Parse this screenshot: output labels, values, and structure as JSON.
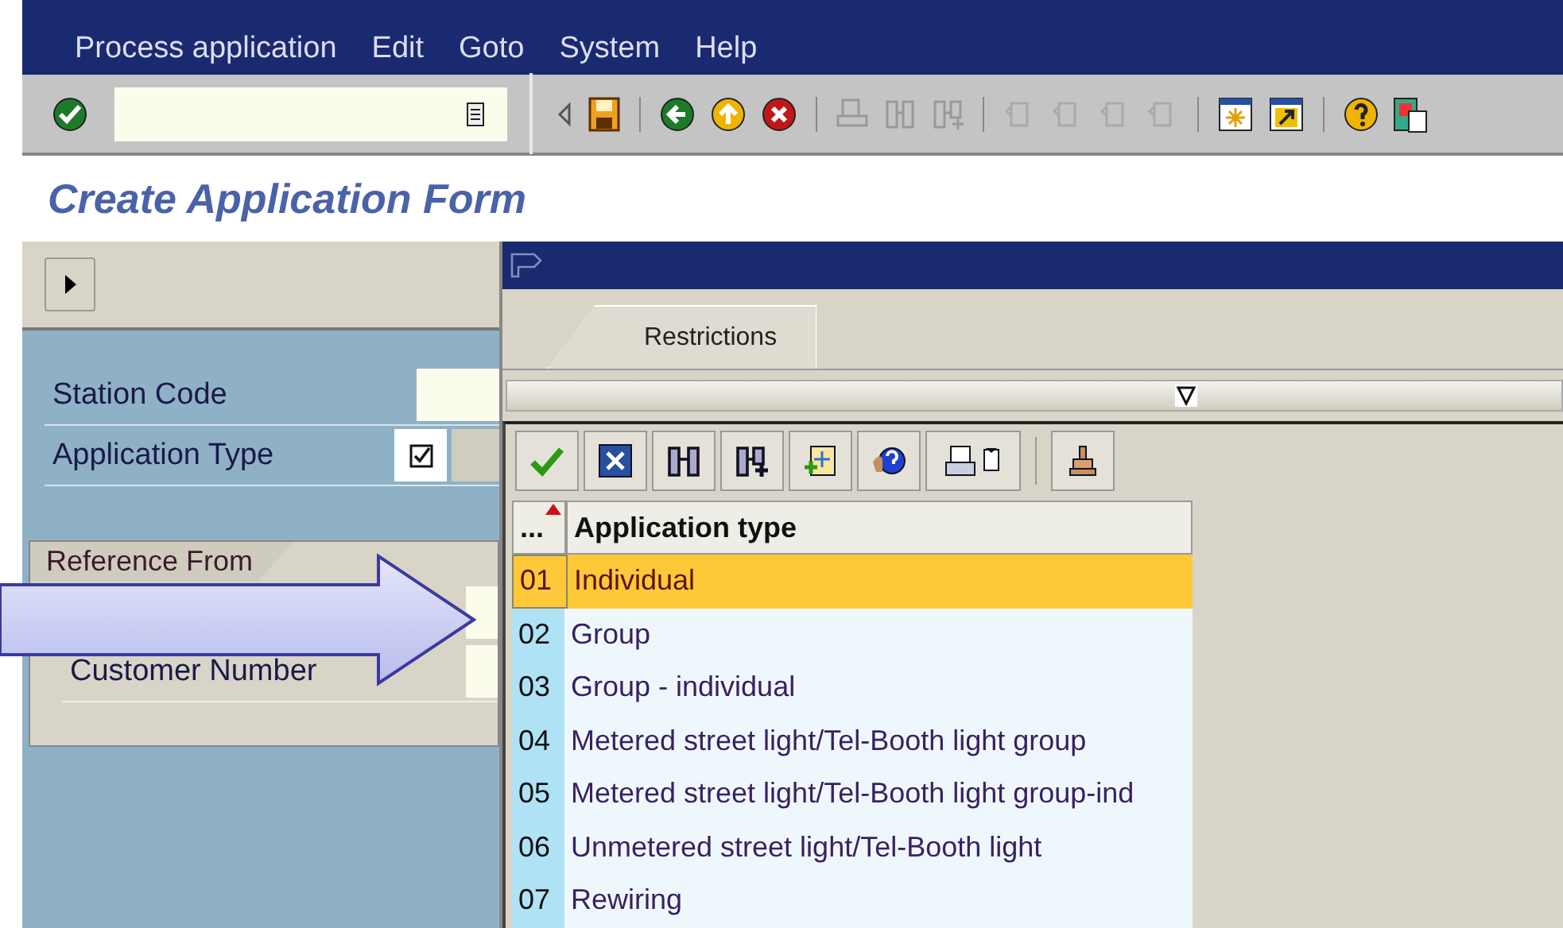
{
  "menu": [
    "Process application",
    "Edit",
    "Goto",
    "System",
    "Help"
  ],
  "title": "Create Application Form",
  "side_panel": {
    "fields": [
      {
        "label": "Station Code",
        "kind": "input"
      },
      {
        "label": "Application Type",
        "kind": "lookup"
      }
    ],
    "group": {
      "title": "Reference From",
      "fields": [
        {
          "label": "Customer Number",
          "kind": "input"
        }
      ]
    }
  },
  "dialog": {
    "tabs": [
      {
        "label": "Restrictions",
        "selected": true
      }
    ],
    "table": {
      "columns": [
        "...",
        "Application type"
      ],
      "rows": [
        {
          "code": "01",
          "text": "Individual",
          "selected": true
        },
        {
          "code": "02",
          "text": "Group",
          "selected": false
        },
        {
          "code": "03",
          "text": "Group - individual",
          "selected": false
        },
        {
          "code": "04",
          "text": "Metered street light/Tel-Booth light group",
          "selected": false
        },
        {
          "code": "05",
          "text": "Metered street light/Tel-Booth light group-ind",
          "selected": false
        },
        {
          "code": "06",
          "text": "Unmetered street light/Tel-Booth light",
          "selected": false
        },
        {
          "code": "07",
          "text": "Rewiring",
          "selected": false
        }
      ]
    }
  }
}
